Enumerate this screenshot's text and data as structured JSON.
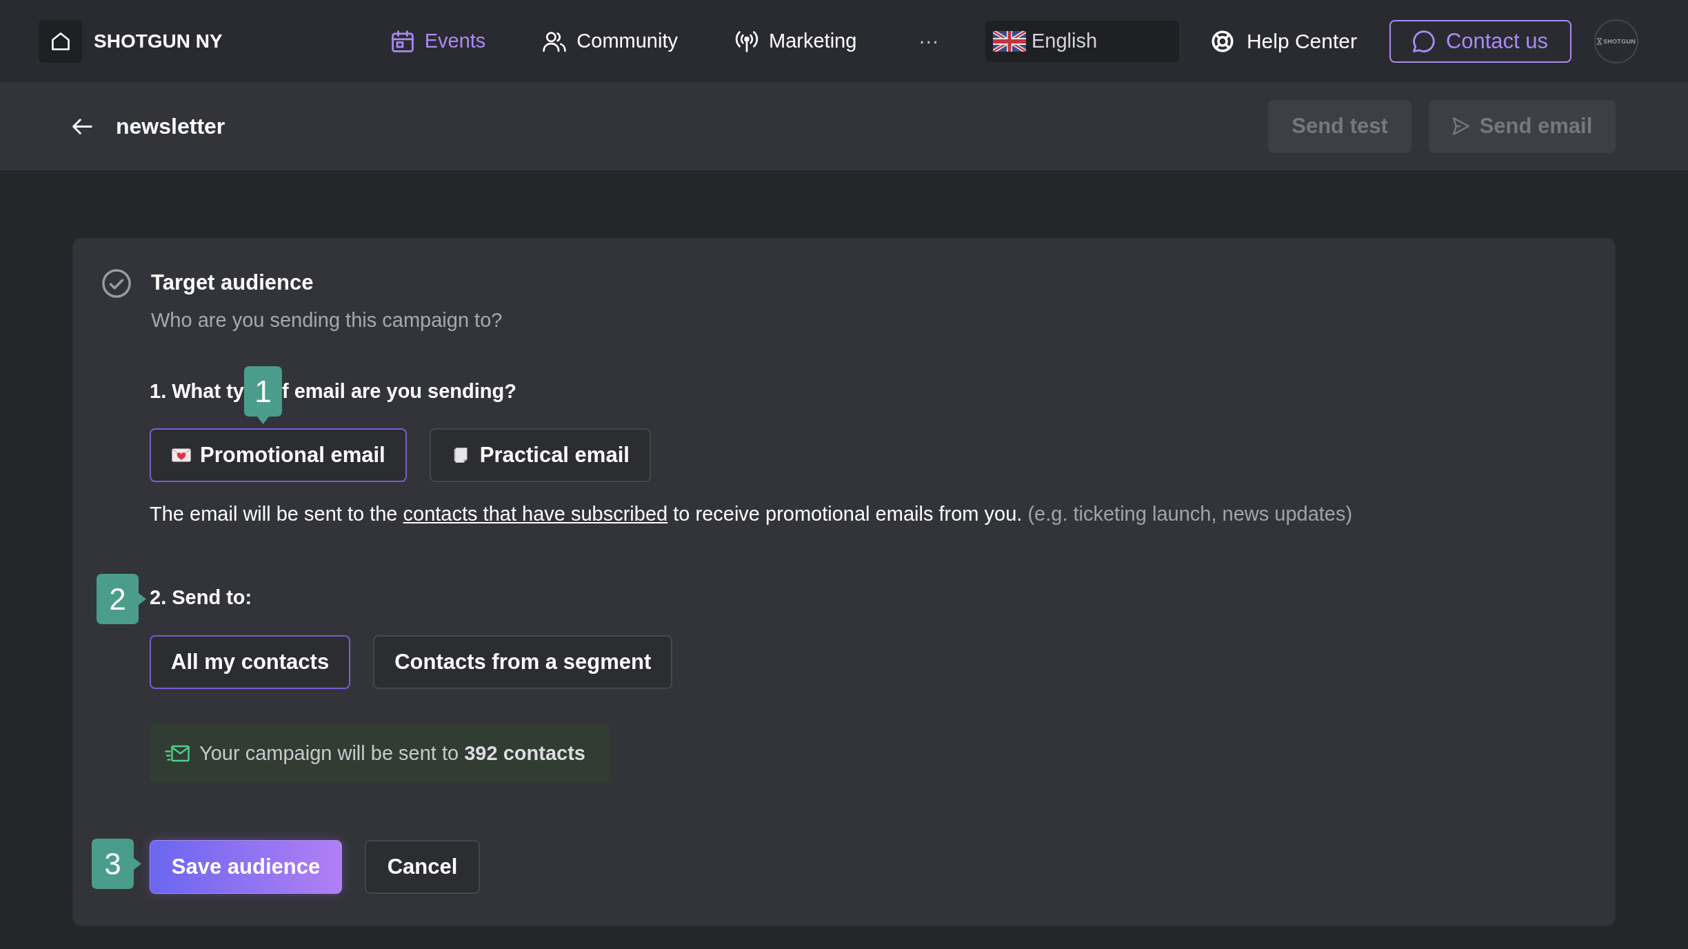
{
  "top_nav": {
    "brand": "SHOTGUN NY",
    "items": [
      {
        "label": "Events",
        "selected": true
      },
      {
        "label": "Community",
        "selected": false
      },
      {
        "label": "Marketing",
        "selected": false
      }
    ],
    "more": "···",
    "language": "English",
    "help": "Help Center",
    "contact": "Contact us",
    "avatar_logo": "SHOTGUN"
  },
  "header": {
    "title": "newsletter",
    "buttons": [
      {
        "label": "Send test",
        "kind": "plain",
        "disabled": true
      },
      {
        "label": "Send email",
        "kind": "send",
        "disabled": true
      }
    ]
  },
  "section": {
    "title": "Target audience",
    "subtitle": "Who are you sending this campaign to?",
    "question_1": {
      "heading_start": "1. What ty",
      "step_badge": "1",
      "heading_end": "f email are you sending?",
      "options": [
        {
          "label": "Promotional email",
          "kind": "promotional",
          "selected": true
        },
        {
          "label": "Practical email",
          "kind": "practical",
          "selected": false
        }
      ],
      "description": {
        "before": "The email will be sent to the ",
        "link": "contacts that have subscribed",
        "after": " to receive promotional emails from you. ",
        "hint": "(e.g. ticketing launch, news updates)"
      }
    },
    "question_2": {
      "step_badge": "2",
      "heading": "2. Send to:",
      "options": [
        {
          "label": "All my contacts",
          "selected": true
        },
        {
          "label": "Contacts from a segment",
          "selected": false
        }
      ],
      "notice": "Your campaign will be sent to **392 contacts**"
    },
    "actions": {
      "step_badge": "3",
      "buttons": [
        {
          "label": "Save audience",
          "kind": "primary"
        },
        {
          "label": "Cancel",
          "kind": "secondary"
        }
      ]
    }
  }
}
